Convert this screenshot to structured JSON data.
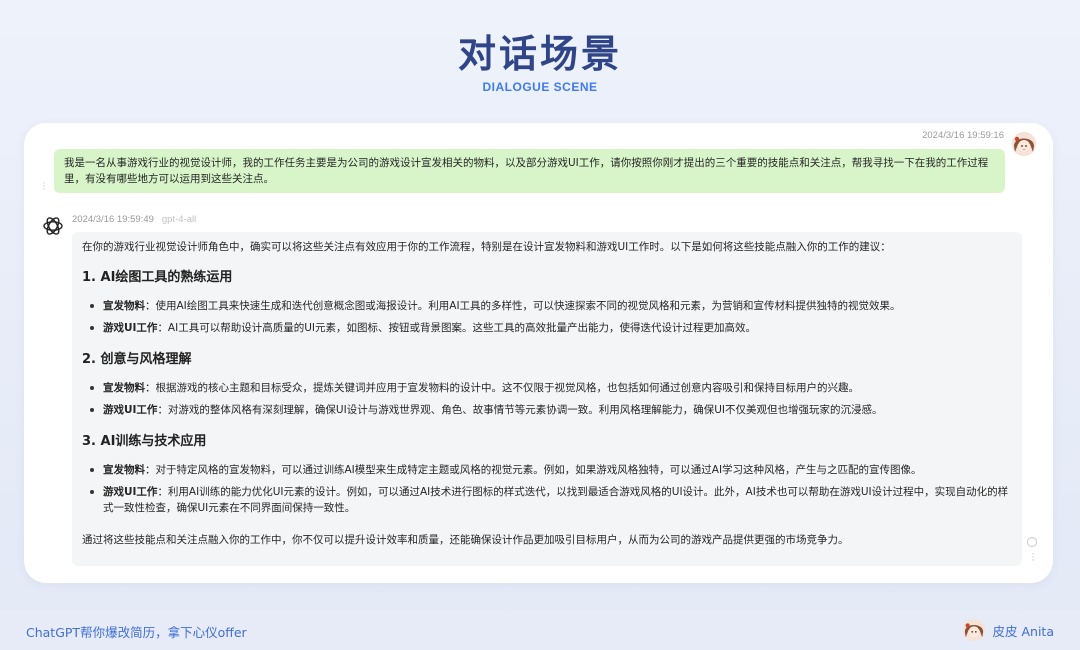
{
  "header": {
    "title": "对话场景",
    "subtitle": "DIALOGUE SCENE"
  },
  "user_message": {
    "timestamp": "2024/3/16 19:59:16",
    "text": "我是一名从事游戏行业的视觉设计师，我的工作任务主要是为公司的游戏设计宣发相关的物料，以及部分游戏UI工作，请你按照你刚才提出的三个重要的技能点和关注点，帮我寻找一下在我的工作过程里，有没有哪些地方可以运用到这些关注点。"
  },
  "assistant_message": {
    "timestamp": "2024/3/16 19:59:49",
    "model": "gpt-4-all",
    "intro": "在你的游戏行业视觉设计师角色中，确实可以将这些关注点有效应用于你的工作流程，特别是在设计宣发物料和游戏UI工作时。以下是如何将这些技能点融入你的工作的建议：",
    "sections": [
      {
        "heading": "1. AI绘图工具的熟练运用",
        "items": [
          {
            "label": "宣发物料",
            "text": "：使用AI绘图工具来快速生成和迭代创意概念图或海报设计。利用AI工具的多样性，可以快速探索不同的视觉风格和元素，为营销和宣传材料提供独特的视觉效果。"
          },
          {
            "label": "游戏UI工作",
            "text": "：AI工具可以帮助设计高质量的UI元素，如图标、按钮或背景图案。这些工具的高效批量产出能力，使得迭代设计过程更加高效。"
          }
        ]
      },
      {
        "heading": "2. 创意与风格理解",
        "items": [
          {
            "label": "宣发物料",
            "text": "：根据游戏的核心主题和目标受众，提炼关键词并应用于宣发物料的设计中。这不仅限于视觉风格，也包括如何通过创意内容吸引和保持目标用户的兴趣。"
          },
          {
            "label": "游戏UI工作",
            "text": "：对游戏的整体风格有深刻理解，确保UI设计与游戏世界观、角色、故事情节等元素协调一致。利用风格理解能力，确保UI不仅美观但也增强玩家的沉浸感。"
          }
        ]
      },
      {
        "heading": "3. AI训练与技术应用",
        "items": [
          {
            "label": "宣发物料",
            "text": "：对于特定风格的宣发物料，可以通过训练AI模型来生成特定主题或风格的视觉元素。例如，如果游戏风格独特，可以通过AI学习这种风格，产生与之匹配的宣传图像。"
          },
          {
            "label": "游戏UI工作",
            "text": "：利用AI训练的能力优化UI元素的设计。例如，可以通过AI技术进行图标的样式迭代，以找到最适合游戏风格的UI设计。此外，AI技术也可以帮助在游戏UI设计过程中，实现自动化的样式一致性检查，确保UI元素在不同界面间保持一致性。"
          }
        ]
      }
    ],
    "outro": "通过将这些技能点和关注点融入你的工作中，你不仅可以提升设计效率和质量，还能确保设计作品更加吸引目标用户，从而为公司的游戏产品提供更强的市场竞争力。"
  },
  "footer": {
    "left_text": "ChatGPT帮你爆改简历，拿下心仪offer",
    "author": "皮皮 Anita"
  },
  "colors": {
    "title": "#2f4587",
    "accent": "#3f7af0",
    "user_bubble": "#d8f5c9",
    "answer_bg": "#f4f5f7",
    "footer_text": "#3f6fd8"
  },
  "icons": {
    "assistant": "openai-logo-icon",
    "user": "user-avatar",
    "author": "author-avatar"
  }
}
